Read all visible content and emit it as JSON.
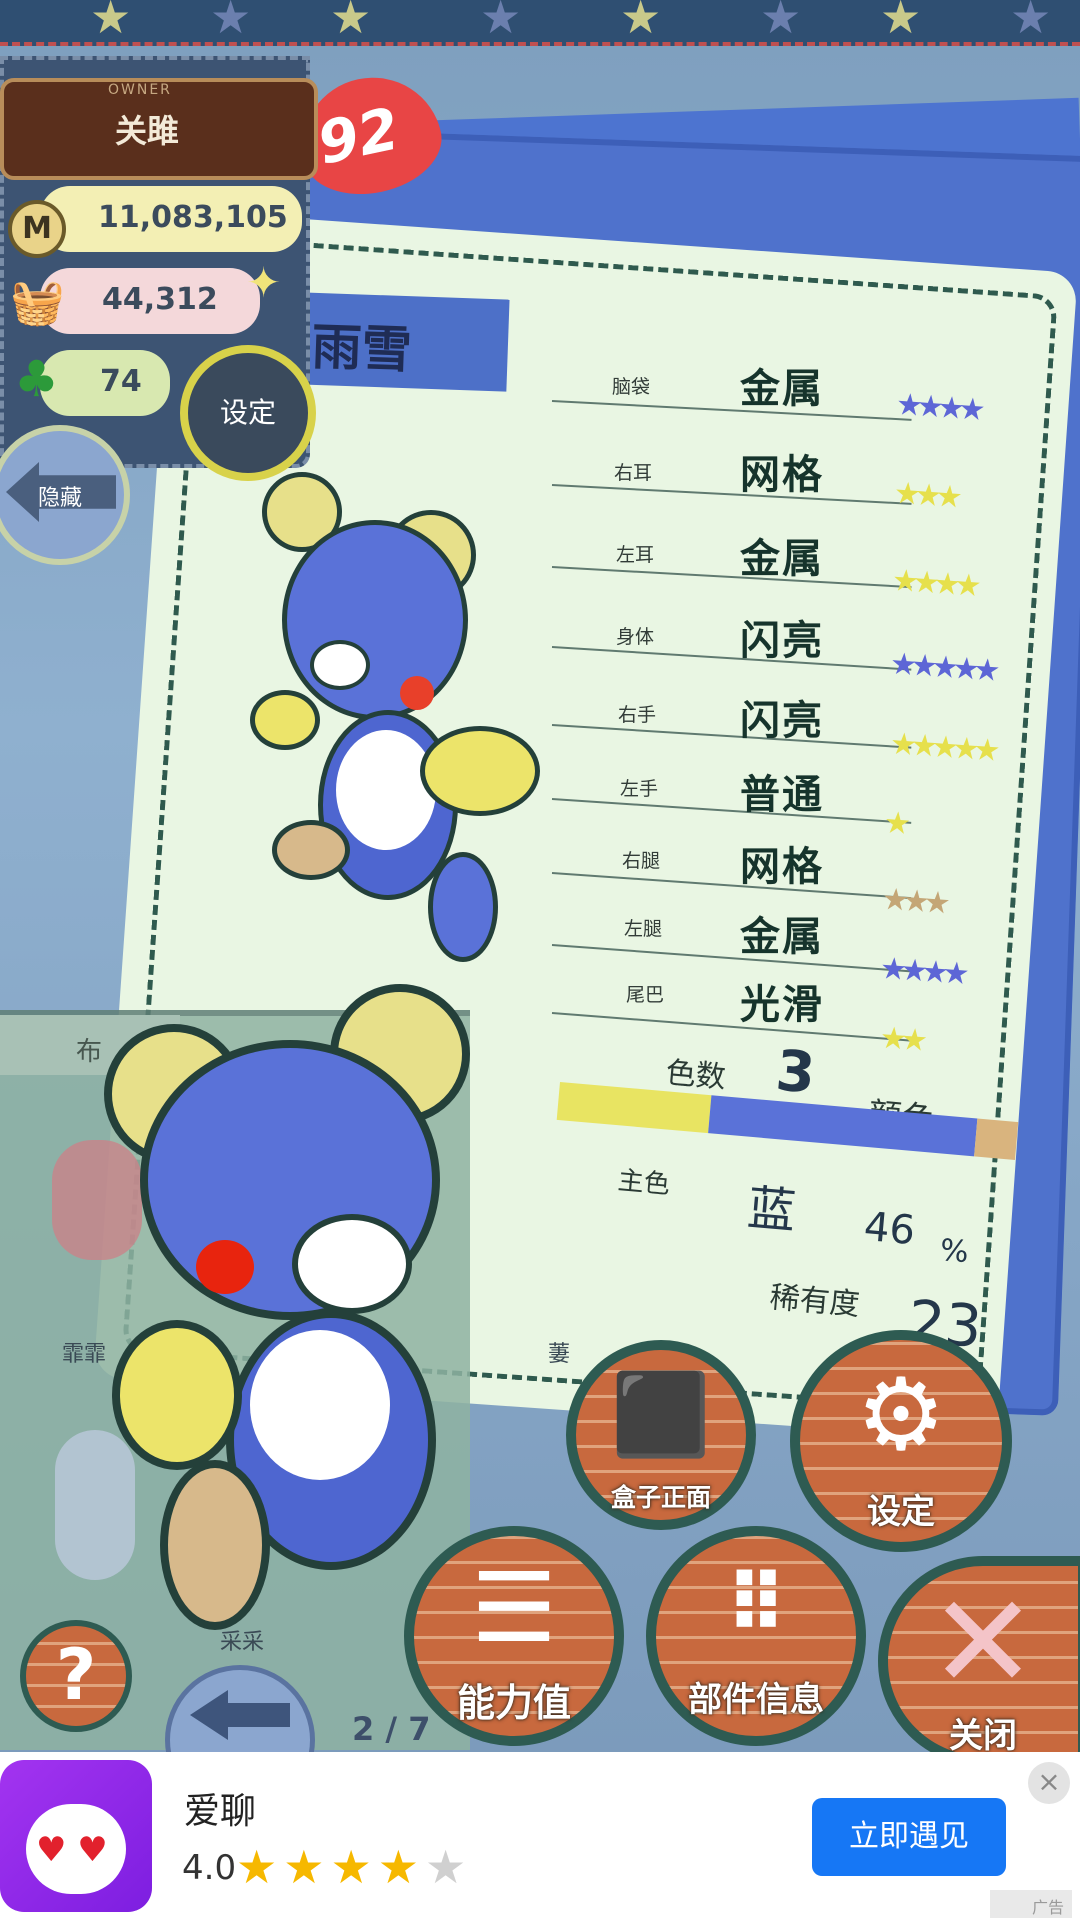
{
  "owner": {
    "caption": "OWNER",
    "name": "关雎",
    "level": "92",
    "money": "11,083,105",
    "coin_symbol": "M",
    "food": "44,312",
    "clover": "74",
    "settings_label": "设定",
    "hide_label": "隐藏"
  },
  "doll": {
    "name": "雨雪",
    "parts": [
      {
        "label": "脑袋",
        "material": "金属",
        "stars": 4,
        "star_color": "#5d66d6"
      },
      {
        "label": "右耳",
        "material": "网格",
        "stars": 3,
        "star_color": "#e6e04c"
      },
      {
        "label": "左耳",
        "material": "金属",
        "stars": 4,
        "star_color": "#e6e04c"
      },
      {
        "label": "身体",
        "material": "闪亮",
        "stars": 5,
        "star_color": "#5d66d6"
      },
      {
        "label": "右手",
        "material": "闪亮",
        "stars": 5,
        "star_color": "#e6e04c"
      },
      {
        "label": "左手",
        "material": "普通",
        "stars": 1,
        "star_color": "#e6e04c"
      },
      {
        "label": "右腿",
        "material": "网格",
        "stars": 3,
        "star_color": "#c4a676"
      },
      {
        "label": "左腿",
        "material": "金属",
        "stars": 4,
        "star_color": "#5d66d6"
      },
      {
        "label": "尾巴",
        "material": "光滑",
        "stars": 2,
        "star_color": "#e6e04c"
      }
    ],
    "color_count_label": "色数",
    "color_count": "3",
    "color_suffix": "颜色",
    "color_segments": [
      {
        "color": "#e8e462",
        "fraction": 0.33
      },
      {
        "color": "#5a72d8",
        "fraction": 0.58
      },
      {
        "color": "#d9b47e",
        "fraction": 0.09
      }
    ],
    "main_color_label": "主色",
    "main_color": "蓝",
    "main_percent": "46",
    "percent_sign": "%",
    "rarity_label": "稀有度",
    "rarity": "23"
  },
  "lower_panel": {
    "tab_label": "布",
    "doll_names": [
      "霏霏",
      "采采",
      "萋"
    ],
    "page": "2 / 7"
  },
  "buttons": {
    "box_front": "盒子正面",
    "settings": "设定",
    "stats": "能力值",
    "parts_info": "部件信息",
    "close": "关闭",
    "help": "?"
  },
  "ad": {
    "title": "爱聊",
    "rating": "4.0",
    "stars_filled": 4,
    "stars_total": 5,
    "cta": "立即遇见",
    "close": "×",
    "mark": "广告"
  },
  "icons": {
    "coin": "coin-icon",
    "food": "basket-icon",
    "clover": "clover-icon",
    "sparkle": "sparkle-icon"
  }
}
